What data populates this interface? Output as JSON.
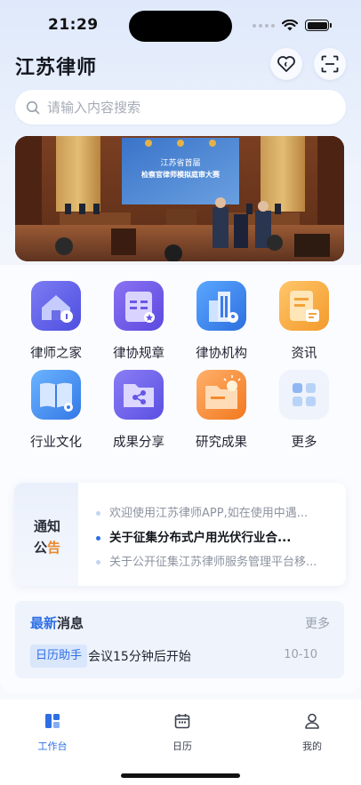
{
  "status": {
    "time": "21:29"
  },
  "header": {
    "title": "江苏律师"
  },
  "search": {
    "placeholder": "请输入内容搜索"
  },
  "banner": {
    "screen_line1": "江苏省首届",
    "screen_line2": "检察官律师模拟庭审大赛"
  },
  "grid": [
    {
      "label": "律师之家",
      "icon": "lawyer-home-icon"
    },
    {
      "label": "律协规章",
      "icon": "rules-book-icon"
    },
    {
      "label": "律协机构",
      "icon": "organization-building-icon"
    },
    {
      "label": "资讯",
      "icon": "news-icon"
    },
    {
      "label": "行业文化",
      "icon": "culture-book-icon"
    },
    {
      "label": "成果分享",
      "icon": "share-folder-icon"
    },
    {
      "label": "研究成果",
      "icon": "research-folder-icon"
    },
    {
      "label": "更多",
      "icon": "more-grid-icon"
    }
  ],
  "notice": {
    "tag_line1": "通知",
    "tag_line2_a": "公",
    "tag_line2_b": "告",
    "items": [
      "欢迎使用江苏律师APP,如在使用中遇...",
      "关于征集分布式户用光伏行业合...",
      "关于公开征集江苏律师服务管理平台移..."
    ]
  },
  "messages": {
    "title_highlight": "最新",
    "title_rest": "消息",
    "more": "更多",
    "badge": "日历助手",
    "text": "会议15分钟后开始",
    "date": "10-10"
  },
  "tabbar": [
    {
      "label": "工作台",
      "icon": "workbench-icon",
      "active": true
    },
    {
      "label": "日历",
      "icon": "calendar-icon",
      "active": false
    },
    {
      "label": "我的",
      "icon": "profile-icon",
      "active": false
    }
  ],
  "colors": {
    "accent": "#2f6fe4",
    "notice_accent": "#e98a2e"
  }
}
